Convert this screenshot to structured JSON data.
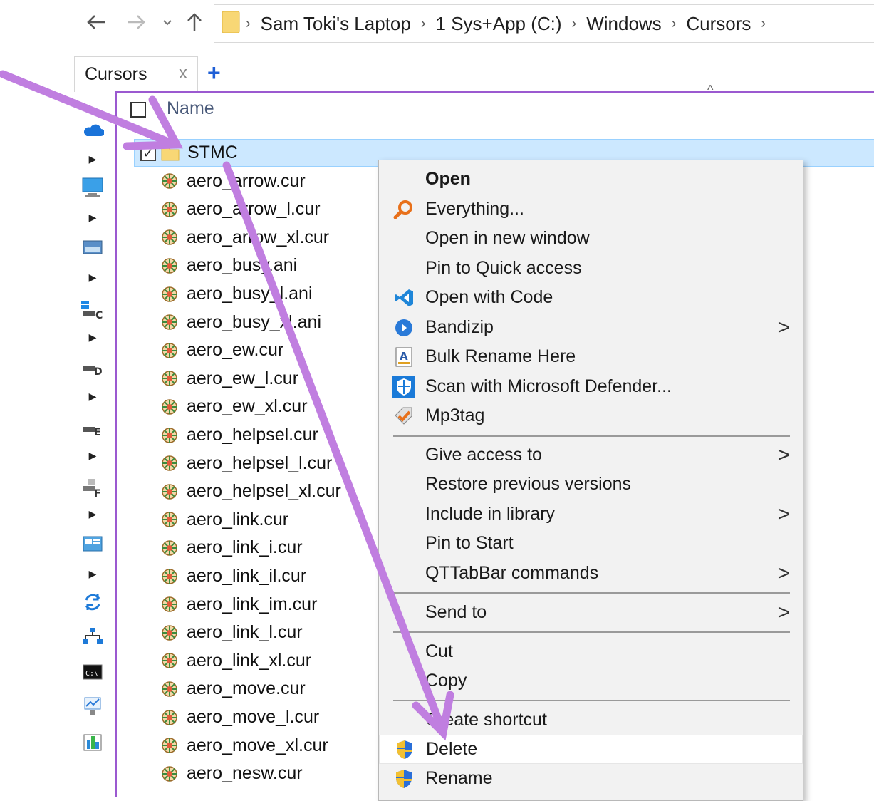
{
  "address": {
    "breadcrumbs": [
      "Sam Toki's Laptop",
      "1 Sys+App (C:)",
      "Windows",
      "Cursors"
    ]
  },
  "tab": {
    "label": "Cursors",
    "close": "x",
    "add": "+"
  },
  "header": {
    "name_column": "Name"
  },
  "files": [
    {
      "name": "STMC",
      "type": "folder",
      "selected": true
    },
    {
      "name": "aero_arrow.cur",
      "type": "cursor"
    },
    {
      "name": "aero_arrow_l.cur",
      "type": "cursor"
    },
    {
      "name": "aero_arrow_xl.cur",
      "type": "cursor"
    },
    {
      "name": "aero_busy.ani",
      "type": "cursor"
    },
    {
      "name": "aero_busy_l.ani",
      "type": "cursor"
    },
    {
      "name": "aero_busy_xl.ani",
      "type": "cursor"
    },
    {
      "name": "aero_ew.cur",
      "type": "cursor"
    },
    {
      "name": "aero_ew_l.cur",
      "type": "cursor"
    },
    {
      "name": "aero_ew_xl.cur",
      "type": "cursor"
    },
    {
      "name": "aero_helpsel.cur",
      "type": "cursor"
    },
    {
      "name": "aero_helpsel_l.cur",
      "type": "cursor"
    },
    {
      "name": "aero_helpsel_xl.cur",
      "type": "cursor"
    },
    {
      "name": "aero_link.cur",
      "type": "cursor"
    },
    {
      "name": "aero_link_i.cur",
      "type": "cursor"
    },
    {
      "name": "aero_link_il.cur",
      "type": "cursor"
    },
    {
      "name": "aero_link_im.cur",
      "type": "cursor"
    },
    {
      "name": "aero_link_l.cur",
      "type": "cursor"
    },
    {
      "name": "aero_link_xl.cur",
      "type": "cursor"
    },
    {
      "name": "aero_move.cur",
      "type": "cursor"
    },
    {
      "name": "aero_move_l.cur",
      "type": "cursor"
    },
    {
      "name": "aero_move_xl.cur",
      "type": "cursor"
    },
    {
      "name": "aero_nesw.cur",
      "type": "cursor"
    }
  ],
  "context_menu": {
    "items": [
      {
        "label": "Open",
        "icon": "none",
        "bold": true
      },
      {
        "label": "Everything...",
        "icon": "everything-search-icon"
      },
      {
        "label": "Open in new window",
        "icon": "none"
      },
      {
        "label": "Pin to Quick access",
        "icon": "none"
      },
      {
        "label": "Open with Code",
        "icon": "vscode-icon"
      },
      {
        "label": "Bandizip",
        "icon": "bandizip-icon",
        "submenu": true
      },
      {
        "label": "Bulk Rename Here",
        "icon": "bulk-rename-icon"
      },
      {
        "label": "Scan with Microsoft Defender...",
        "icon": "defender-shield-icon"
      },
      {
        "label": "Mp3tag",
        "icon": "mp3tag-icon"
      },
      {
        "label": "Give access to",
        "icon": "none",
        "submenu": true
      },
      {
        "label": "Restore previous versions",
        "icon": "none"
      },
      {
        "label": "Include in library",
        "icon": "none",
        "submenu": true
      },
      {
        "label": "Pin to Start",
        "icon": "none"
      },
      {
        "label": "QTTabBar commands",
        "icon": "none",
        "submenu": true
      },
      {
        "label": "Send to",
        "icon": "none",
        "submenu": true
      },
      {
        "label": "Cut",
        "icon": "none"
      },
      {
        "label": "Copy",
        "icon": "none"
      },
      {
        "label": "Create shortcut",
        "icon": "none"
      },
      {
        "label": "Delete",
        "icon": "uac-shield-icon",
        "hover": true
      },
      {
        "label": "Rename",
        "icon": "uac-shield-icon"
      }
    ],
    "submenu_glyph": ">"
  },
  "colors": {
    "selection": "#cce8ff",
    "frame_border": "#9b59d0",
    "annotation_arrow": "#c07ee0",
    "accent_blue": "#1f5fd6"
  }
}
